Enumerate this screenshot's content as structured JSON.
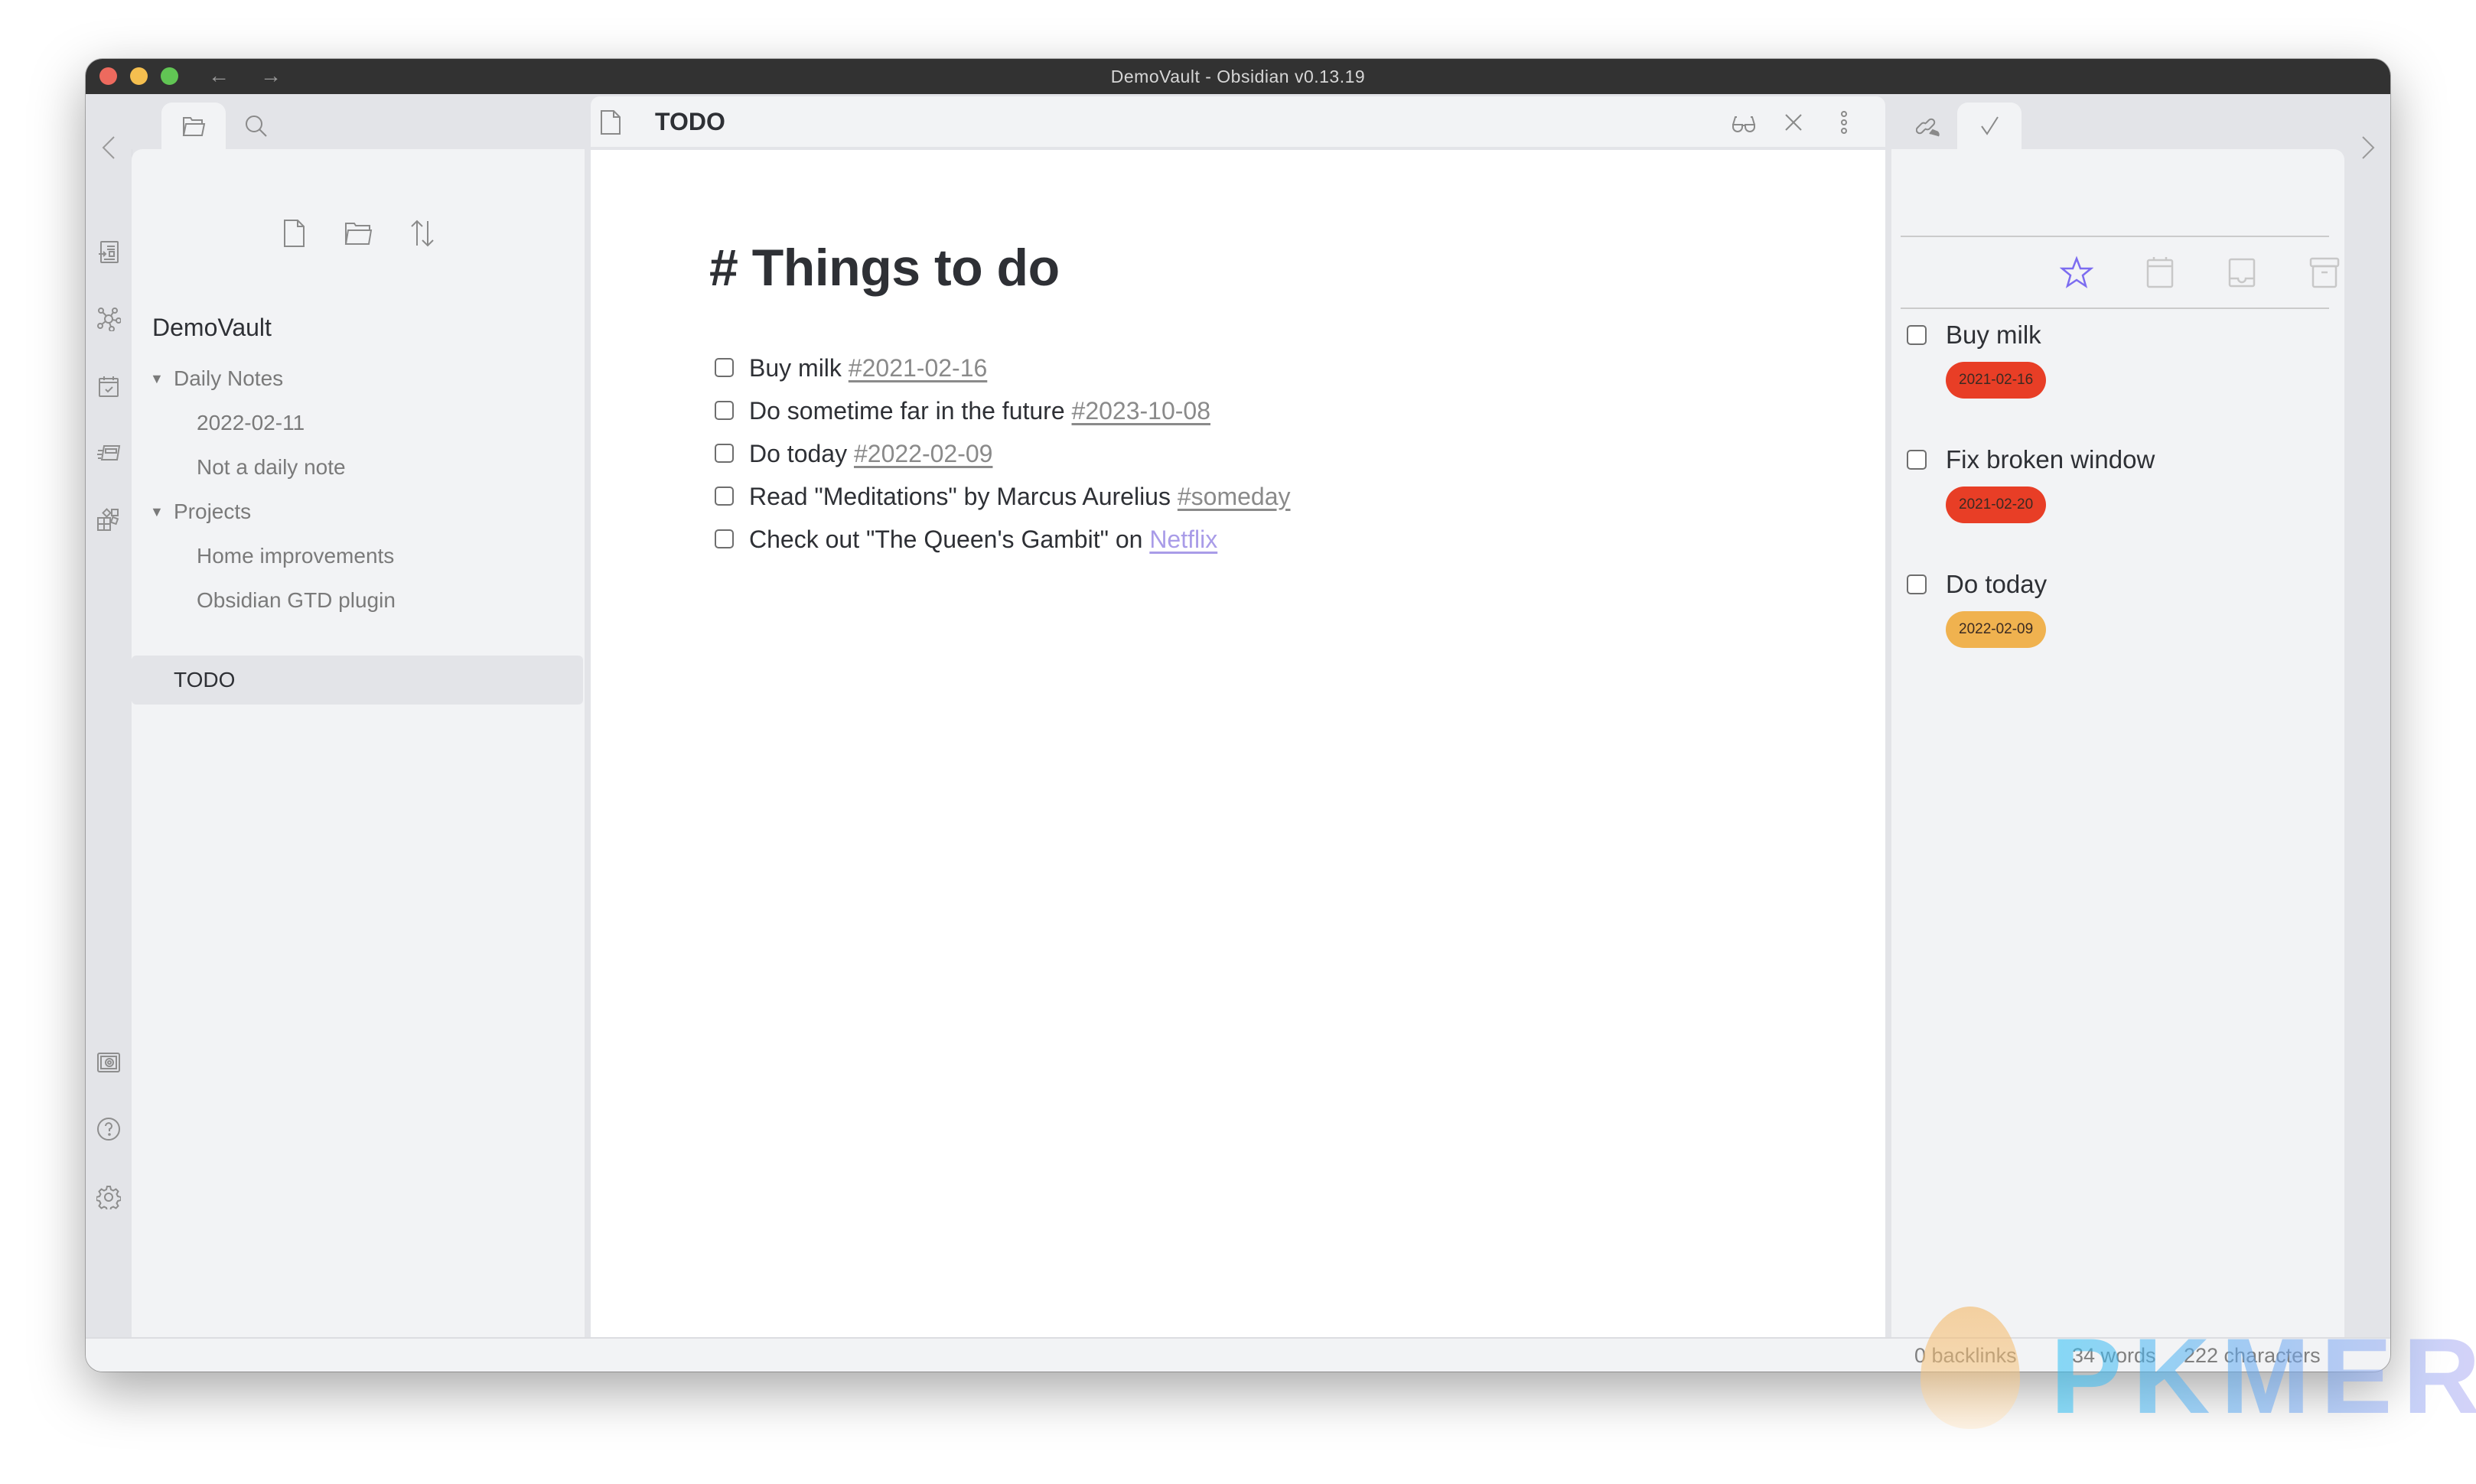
{
  "window": {
    "title": "DemoVault - Obsidian v0.13.19",
    "back_label": "←",
    "forward_label": "→"
  },
  "left_ribbon": {
    "top_icons": [
      "open-quick-switcher-icon",
      "graph-view-icon",
      "daily-note-calendar-icon",
      "slides-icon",
      "plugins-icon"
    ],
    "bottom_icons": [
      "vault-switcher-icon",
      "help-icon",
      "settings-icon"
    ]
  },
  "left_sidebar": {
    "tabs": [
      {
        "name": "file-explorer",
        "active": true
      },
      {
        "name": "search",
        "active": false
      }
    ],
    "actions": [
      "new-note",
      "new-folder",
      "change-sort-order"
    ],
    "vault_name": "DemoVault",
    "tree": [
      {
        "label": "Daily Notes",
        "type": "folder",
        "expanded": true,
        "depth": 0
      },
      {
        "label": "2022-02-11",
        "type": "file",
        "depth": 1
      },
      {
        "label": "Not a daily note",
        "type": "file",
        "depth": 1
      },
      {
        "label": "Projects",
        "type": "folder",
        "expanded": true,
        "depth": 0
      },
      {
        "label": "Home improvements",
        "type": "file",
        "depth": 1
      },
      {
        "label": "Obsidian GTD plugin",
        "type": "file",
        "depth": 1
      },
      {
        "label": "TODO",
        "type": "file",
        "depth": 0,
        "selected": true
      }
    ],
    "collapse_label": "‹"
  },
  "editor": {
    "tab_title": "TODO",
    "actions": [
      "preview-mode",
      "close",
      "more-options"
    ],
    "heading": "# Things to do",
    "tasks": [
      {
        "text": "Buy milk ",
        "tag": "#2021-02-16",
        "checked": false
      },
      {
        "text": "Do sometime far in the future ",
        "tag": "#2023-10-08",
        "checked": false
      },
      {
        "text": "Do today ",
        "tag": "#2022-02-09",
        "checked": false
      },
      {
        "text": "Read \"Meditations\" by Marcus Aurelius ",
        "tag": "#someday",
        "checked": false
      },
      {
        "text": "Check out \"The Queen's Gambit\" on ",
        "link": "Netflix",
        "checked": false
      }
    ]
  },
  "right_sidebar": {
    "tabs": [
      {
        "name": "backlinks",
        "active": false
      },
      {
        "name": "gtd-tasks",
        "active": true
      }
    ],
    "toolbar": [
      {
        "name": "priority-star",
        "active": true
      },
      {
        "name": "calendar",
        "active": false
      },
      {
        "name": "inbox",
        "active": false
      },
      {
        "name": "archive",
        "active": false
      }
    ],
    "tasks": [
      {
        "title": "Buy milk",
        "date": "2021-02-16",
        "badge_color": "#e83e26",
        "checked": false
      },
      {
        "title": "Fix broken window",
        "date": "2021-02-20",
        "badge_color": "#e83e26",
        "checked": false
      },
      {
        "title": "Do today",
        "date": "2022-02-09",
        "badge_color": "#f0b24f",
        "checked": false
      }
    ],
    "accent_color": "#7c6cf0"
  },
  "status_bar": {
    "backlinks": "0 backlinks",
    "words": "34 words",
    "characters": "222 characters"
  },
  "watermark": {
    "text": "PKMER"
  }
}
